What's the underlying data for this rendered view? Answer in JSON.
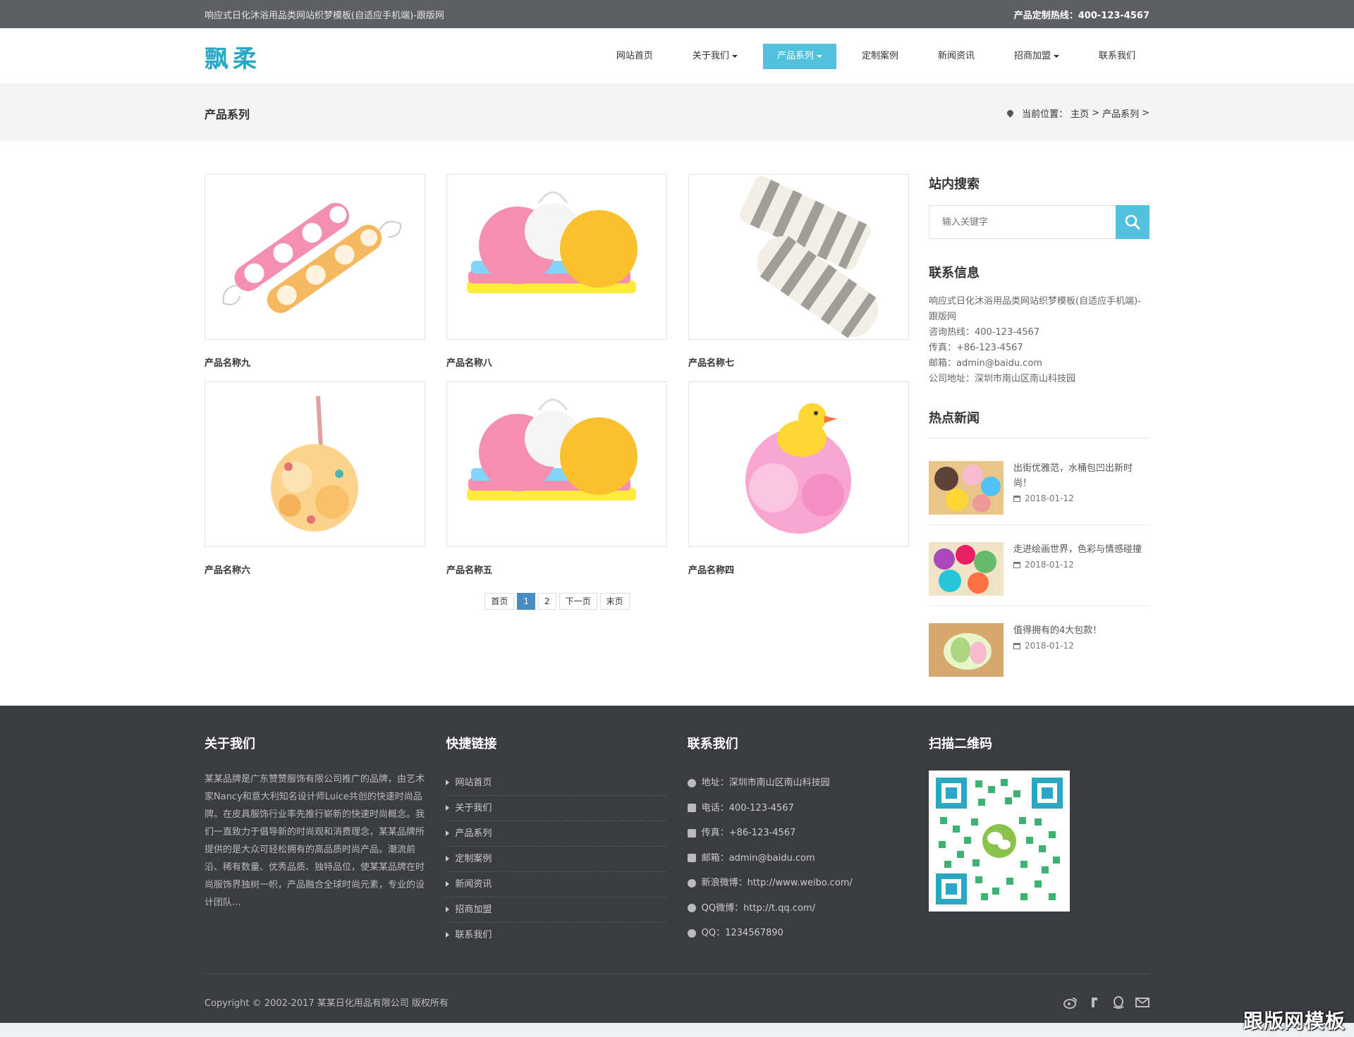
{
  "topbar": {
    "site_name": "响应式日化沐浴用品类网站织梦模板(自适应手机端)-跟版网",
    "hotline_label": "产品定制热线：",
    "hotline": "400-123-4567"
  },
  "header": {
    "logo": "飘柔",
    "nav": [
      {
        "label": "网站首页"
      },
      {
        "label": "关于我们"
      },
      {
        "label": "产品系列"
      },
      {
        "label": "定制案例"
      },
      {
        "label": "新闻资讯"
      },
      {
        "label": "招商加盟"
      },
      {
        "label": "联系我们"
      }
    ]
  },
  "pagebar": {
    "title": "产品系列",
    "crumb_label": "当前位置：",
    "crumb_home": "主页",
    "crumb_sep": ">",
    "crumb_current": "产品系列"
  },
  "products": [
    {
      "name": "产品名称九"
    },
    {
      "name": "产品名称八"
    },
    {
      "name": "产品名称七"
    },
    {
      "name": "产品名称六"
    },
    {
      "name": "产品名称五"
    },
    {
      "name": "产品名称四"
    }
  ],
  "pager": {
    "first": "首页",
    "p1": "1",
    "p2": "2",
    "next": "下一页",
    "last": "末页"
  },
  "sidebar": {
    "search_title": "站内搜索",
    "search_placeholder": "输入关键字",
    "contact_title": "联系信息",
    "contact_lines": [
      "响应式日化沐浴用品类网站织梦模板(自适应手机端)-跟版网",
      "咨询热线：400-123-4567",
      "传真：+86-123-4567",
      "邮箱：admin@baidu.com",
      "公司地址：深圳市南山区南山科技园"
    ],
    "hot_title": "热点新闻",
    "news": [
      {
        "title": "出街优雅范，水桶包凹出新时尚！",
        "date": "2018-01-12"
      },
      {
        "title": "走进绘画世界，色彩与情感碰撞",
        "date": "2018-01-12"
      },
      {
        "title": "值得拥有的4大包款！",
        "date": "2018-01-12"
      }
    ]
  },
  "footer": {
    "about_title": "关于我们",
    "about_text": "某某品牌是广东赞赞服饰有限公司推广的品牌，由艺术家Nancy和意大利知名设计师Luice共创的快速时尚品牌。在皮具服饰行业率先推行崭新的快速时尚概念。我们一直致力于倡导新的时尚观和消费理念，某某品牌所提供的是大众可轻松拥有的高品质时尚产品。潮流前沿、稀有数量、优秀品质、独特品位，使某某品牌在时尚服饰界独树一帜，产品融合全球时尚元素，专业的设计团队...",
    "links_title": "快捷链接",
    "links": [
      "网站首页",
      "关于我们",
      "产品系列",
      "定制案例",
      "新闻资讯",
      "招商加盟",
      "联系我们"
    ],
    "contact_title": "联系我们",
    "contact": [
      "地址：深圳市南山区南山科技园",
      "电话：400-123-4567",
      "传真：+86-123-4567",
      "邮箱：admin@baidu.com",
      "新浪微博：http://www.weibo.com/",
      "QQ微博：http://t.qq.com/",
      "QQ：1234567890"
    ],
    "qr_title": "扫描二维码",
    "copyright": "Copyright © 2002-2017 某某日化用品有限公司 版权所有"
  },
  "watermark": "跟版网模板",
  "colors": {
    "accent": "#51c2dd",
    "topbar": "#5d5e66",
    "footer": "#3b3c41",
    "pager_active": "#4a8bc2"
  }
}
